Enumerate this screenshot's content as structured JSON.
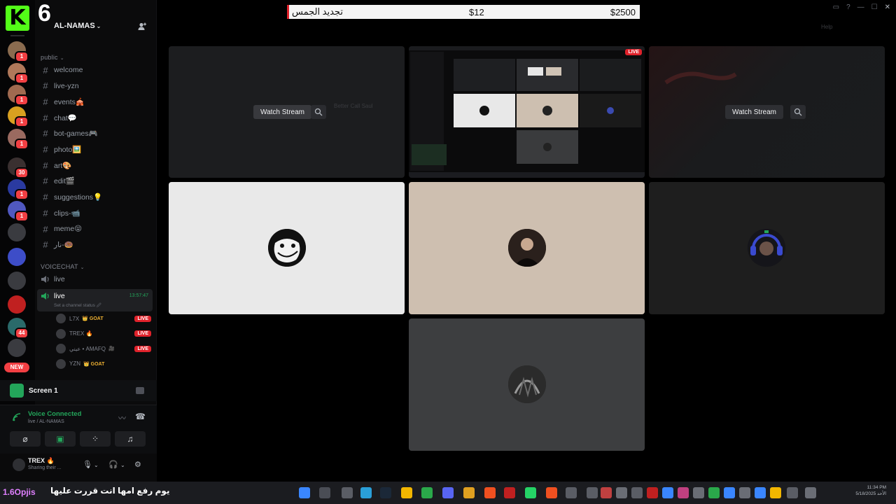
{
  "brand": {
    "letter": "K",
    "follower_count": "6"
  },
  "server": {
    "name": "AL-NAMAS"
  },
  "banner": {
    "label": "تجديد الجمس",
    "price": "$12",
    "amount": "$2500"
  },
  "titlebar": {
    "help_label": "Help"
  },
  "rail": {
    "servers": [
      {
        "badge": "1",
        "color": "#8a6b4f"
      },
      {
        "badge": "1",
        "color": "#b0785a"
      },
      {
        "badge": "1",
        "color": "#a06a50"
      },
      {
        "badge": "1",
        "color": "#d8a020"
      },
      {
        "badge": "1",
        "color": "#9a6a60"
      },
      {
        "badge": "30",
        "color": "#3a3030"
      },
      {
        "badge": "1",
        "color": "#2a3aa0"
      },
      {
        "badge": "1",
        "color": "#5058c0"
      },
      {
        "badge": "",
        "color": "#3a3b40"
      },
      {
        "badge": "",
        "color": "#3d4dc8"
      },
      {
        "badge": "",
        "color": "#3a3b40"
      },
      {
        "badge": "",
        "color": "#c02020"
      },
      {
        "badge": "44",
        "color": "#2a6a6a"
      },
      {
        "badge": "",
        "color": "#3a3b40"
      }
    ],
    "new_label": "NEW"
  },
  "sidebar": {
    "categories": {
      "public": "public",
      "voice": "VOICECHAT"
    },
    "text_channels": [
      "welcome",
      "live-yzn",
      "events🎪",
      "chat💬",
      "bot-games🎮",
      "photo🖼️",
      "art🎨",
      "edit🎬",
      "suggestions💡",
      "clips-📹",
      "meme😝",
      "نار-🍩"
    ],
    "voice_channels": [
      {
        "name": "live",
        "active": false
      },
      {
        "name": "live",
        "active": true,
        "timer": "13:57:47",
        "status": "Set a channel status 🖉"
      }
    ],
    "voice_users": [
      {
        "name": "L7X",
        "tag": "👑 GOAT",
        "live": "LIVE"
      },
      {
        "name": "TREX 🔥",
        "tag": "",
        "live": "LIVE"
      },
      {
        "name": "عيني • AMAFQ",
        "tag": "🎥",
        "live": "LIVE"
      },
      {
        "name": "YZN",
        "tag": "👑 GOAT",
        "live": ""
      }
    ]
  },
  "screen_panel": {
    "label": "Screen 1"
  },
  "voice_panel": {
    "title": "Voice Connected",
    "subtitle": "live / AL-NAMAS"
  },
  "user_panel": {
    "name": "TREX 🔥",
    "status": "Sharing their ..."
  },
  "streams": {
    "watch_label": "Watch Stream",
    "live_tag": "LIVE",
    "ghost_title": "Better Call Saul"
  },
  "taskbar": {
    "handle": "1.6Opjis",
    "ticker": "يوم رفع امها انت قررت عليها",
    "clock_time": "11:34 PM",
    "clock_date": "الأحد 5/18/2025"
  }
}
